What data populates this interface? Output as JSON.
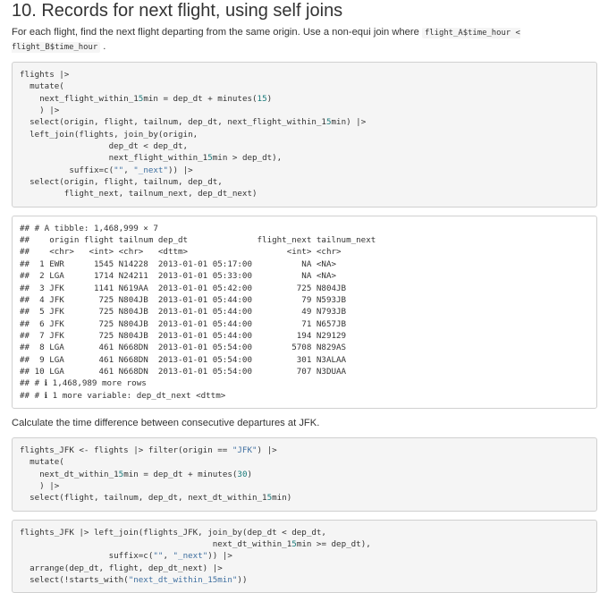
{
  "heading": "10. Records for next flight, using self joins",
  "intro": {
    "text_before": "For each flight, find the next flight departing from the same origin. Use a non-equi join where ",
    "inline_code": "flight_A$time_hour < flight_B$time_hour",
    "text_after": " ."
  },
  "code_block_1": [
    "flights |>",
    "  mutate(",
    "    next_flight_within_15min = dep_dt + minutes(15)",
    "    ) |>",
    "  select(origin, flight, tailnum, dep_dt, next_flight_within_15min) |>",
    "  left_join(flights, join_by(origin,",
    "                  dep_dt < dep_dt,",
    "                  next_flight_within_15min > dep_dt),",
    "          suffix=c(\"\", \"_next\")) |>",
    "  select(origin, flight, tailnum, dep_dt,",
    "         flight_next, tailnum_next, dep_dt_next)"
  ],
  "output_block": [
    "## # A tibble: 1,468,999 × 7",
    "##    origin flight tailnum dep_dt              flight_next tailnum_next",
    "##    <chr>   <int> <chr>   <dttm>                    <int> <chr>",
    "##  1 EWR      1545 N14228  2013-01-01 05:17:00          NA <NA>",
    "##  2 LGA      1714 N24211  2013-01-01 05:33:00          NA <NA>",
    "##  3 JFK      1141 N619AA  2013-01-01 05:42:00         725 N804JB",
    "##  4 JFK       725 N804JB  2013-01-01 05:44:00          79 N593JB",
    "##  5 JFK       725 N804JB  2013-01-01 05:44:00          49 N793JB",
    "##  6 JFK       725 N804JB  2013-01-01 05:44:00          71 N657JB",
    "##  7 JFK       725 N804JB  2013-01-01 05:44:00         194 N29129",
    "##  8 LGA       461 N668DN  2013-01-01 05:54:00        5708 N829AS",
    "##  9 LGA       461 N668DN  2013-01-01 05:54:00         301 N3ALAA",
    "## 10 LGA       461 N668DN  2013-01-01 05:54:00         707 N3DUAA",
    "## # ℹ 1,468,989 more rows",
    "## # ℹ 1 more variable: dep_dt_next <dttm>"
  ],
  "paragraph_2": "Calculate the time difference between consecutive departures at JFK.",
  "code_block_2": [
    "flights_JFK <- flights |> filter(origin == \"JFK\") |>",
    "  mutate(",
    "    next_dt_within_15min = dep_dt + minutes(30)",
    "    ) |>",
    "  select(flight, tailnum, dep_dt, next_dt_within_15min)"
  ],
  "code_block_3": [
    "flights_JFK |> left_join(flights_JFK, join_by(dep_dt < dep_dt,",
    "                                       next_dt_within_15min >= dep_dt),",
    "                  suffix=c(\"\", \"_next\")) |>",
    "  arrange(dep_dt, flight, dep_dt_next) |>",
    "  select(!starts_with(\"next_dt_within_15min\"))"
  ]
}
